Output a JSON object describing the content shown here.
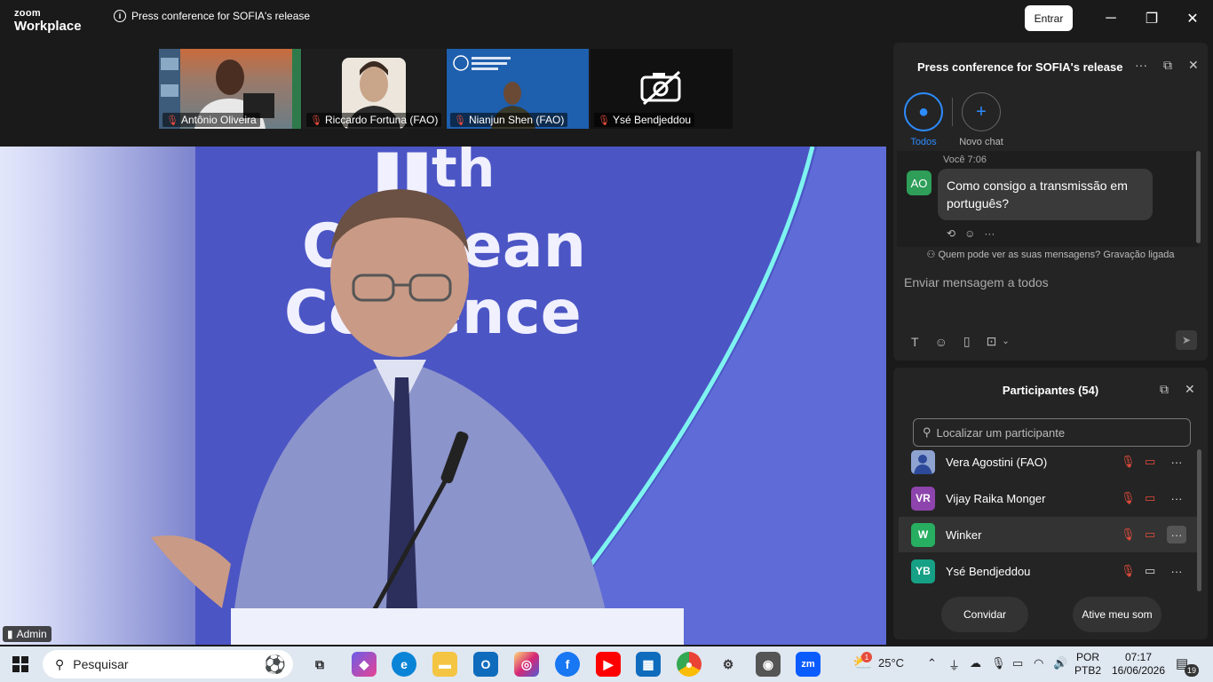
{
  "app": {
    "brand_top": "zoom",
    "brand_bottom": "Workplace",
    "meeting_title": "Press conference for SOFIA's release",
    "enter_label": "Entrar"
  },
  "window_controls": {
    "minimize": "─",
    "maximize": "❐",
    "close": "✕"
  },
  "thumbnails": [
    {
      "name": "Antônio Oliveira"
    },
    {
      "name": "Riccardo Fortuna (FAO)"
    },
    {
      "name": "Nianjun Shen (FAO)"
    },
    {
      "name": "Ysé Bendjeddou"
    }
  ],
  "main_video": {
    "banner_line1": "th",
    "banner_line2": "Ocean",
    "banner_line3": "Conference",
    "badge": "Admin"
  },
  "chat": {
    "title": "Press conference for SOFIA's release",
    "channels": [
      {
        "label": "Todos",
        "icon": "people-icon"
      },
      {
        "label": "Novo chat",
        "icon": "plus-icon"
      }
    ],
    "message": {
      "sender": "Você",
      "time": "7:06",
      "avatar": "AO",
      "text": "Como consigo a transmissão em português?"
    },
    "privacy_note": "Quem pode ver as suas mensagens? Gravação ligada",
    "input_placeholder": "Enviar mensagem a todos"
  },
  "participants": {
    "title": "Participantes (54)",
    "search_placeholder": "Localizar um participante",
    "list": [
      {
        "name": "Vera Agostini (FAO)",
        "initials": "",
        "color": "#3b5bb5",
        "camera": "off"
      },
      {
        "name": "Vijay Raika Monger",
        "initials": "VR",
        "color": "#8e44ad",
        "camera": "off"
      },
      {
        "name": "Winker",
        "initials": "W",
        "color": "#27ae60",
        "camera": "off"
      },
      {
        "name": "Ysé Bendjeddou",
        "initials": "YB",
        "color": "#16a085",
        "camera": "on"
      }
    ],
    "invite_label": "Convidar",
    "unmute_label": "Ative meu som"
  },
  "taskbar": {
    "search_label": "Pesquisar",
    "weather": "25°C",
    "weather_badge": "1",
    "language_top": "POR",
    "language_bottom": "PTB2",
    "time": "07:17",
    "date": "16/06/2026",
    "notification_count": "19",
    "zoom_app": "zm"
  }
}
